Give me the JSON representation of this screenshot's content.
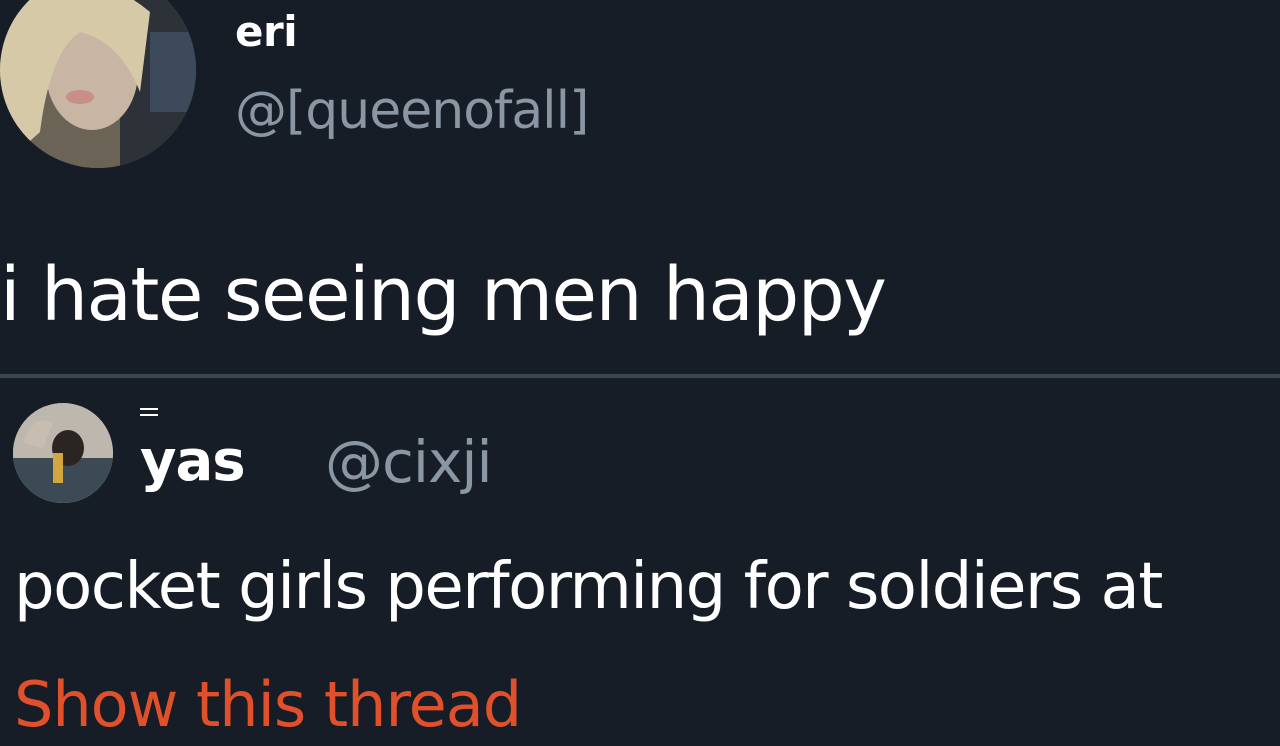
{
  "tweet": {
    "author_name": "eri",
    "author_handle": "@[queenofall]",
    "text": "i hate seeing men happy"
  },
  "reply": {
    "author_name": "yas",
    "author_handle": "@cixji",
    "text": "pocket girls performing for soldiers at",
    "show_thread_label": "Show this thread"
  },
  "colors": {
    "background": "#161d27",
    "text": "#ffffff",
    "handle": "#8a96a3",
    "divider": "#3a4450",
    "link": "#e0502a"
  },
  "icons": {
    "main_avatar": "profile-photo",
    "reply_avatar": "profile-photo"
  }
}
